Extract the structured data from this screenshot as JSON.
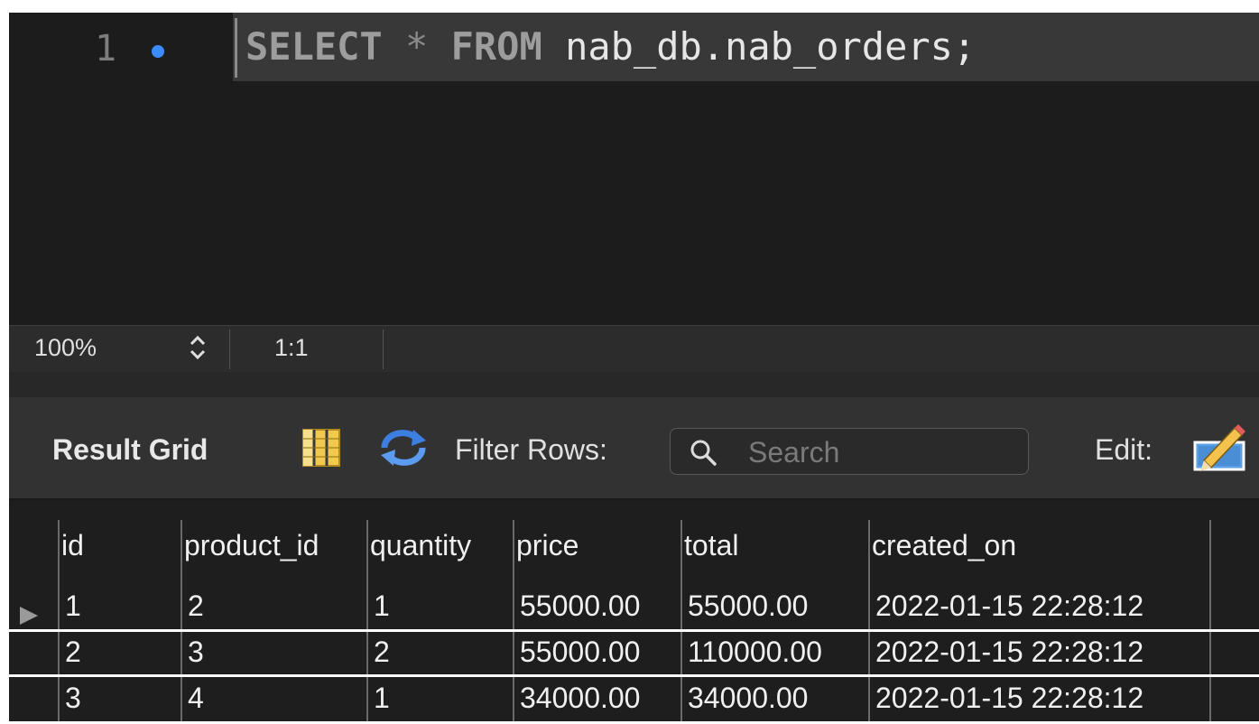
{
  "editor": {
    "line_number": "1",
    "code": {
      "kw_select": "SELECT",
      "op_star": "*",
      "kw_from": "FROM",
      "table": "nab_db.nab_orders;"
    }
  },
  "status": {
    "zoom": "100%",
    "cursor_position": "1:1"
  },
  "toolbar": {
    "result_grid_label": "Result Grid",
    "filter_label": "Filter Rows:",
    "search_placeholder": "Search",
    "edit_label": "Edit:"
  },
  "icons": {
    "grid": "grid-columns-icon",
    "refresh": "refresh-icon",
    "search": "search-icon",
    "edit": "edit-pencil-icon",
    "row_pointer": "current-row-arrow-icon",
    "breakpoint": "breakpoint-dot-icon"
  },
  "colors": {
    "editor_bg": "#1c1c1c",
    "breakpoint": "#3b8cff",
    "keyword": "#9d9d9d",
    "toolbar_bg": "#323232"
  },
  "grid": {
    "columns": [
      "id",
      "product_id",
      "quantity",
      "price",
      "total",
      "created_on"
    ],
    "rows": [
      [
        "1",
        "2",
        "1",
        "55000.00",
        "55000.00",
        "2022-01-15 22:28:12"
      ],
      [
        "2",
        "3",
        "2",
        "55000.00",
        "110000.00",
        "2022-01-15 22:28:12"
      ],
      [
        "3",
        "4",
        "1",
        "34000.00",
        "34000.00",
        "2022-01-15 22:28:12"
      ]
    ]
  }
}
